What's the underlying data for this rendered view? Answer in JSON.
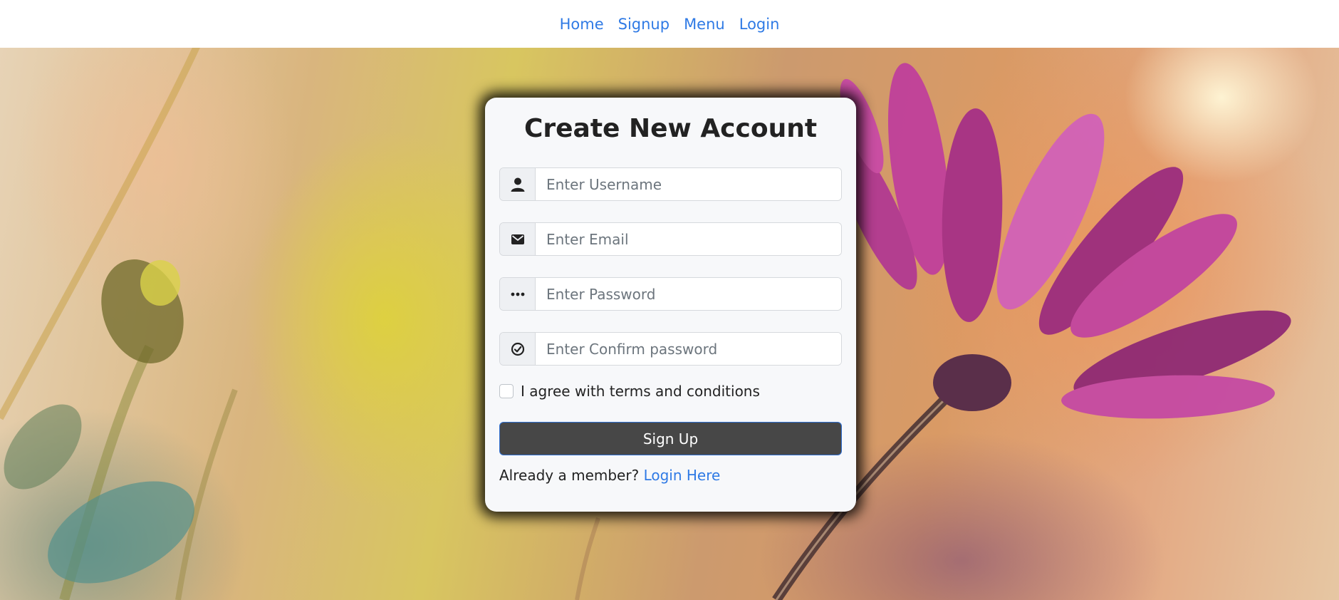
{
  "nav": {
    "items": [
      "Home",
      "Signup",
      "Menu",
      "Login"
    ]
  },
  "form": {
    "title": "Create New Account",
    "fields": [
      {
        "icon": "user-icon",
        "placeholder": "Enter Username",
        "value": ""
      },
      {
        "icon": "envelope-icon",
        "placeholder": "Enter Email",
        "value": ""
      },
      {
        "icon": "password-dots-icon",
        "placeholder": "Enter Password",
        "value": ""
      },
      {
        "icon": "check-circle-icon",
        "placeholder": "Enter Confirm password",
        "value": ""
      }
    ],
    "agree_label": "I agree with terms and conditions",
    "agree_checked": false,
    "submit_label": "Sign Up",
    "member_text": "Already a member?",
    "login_link": "Login Here"
  },
  "colors": {
    "link": "#2f7ae5",
    "button_bg": "#474747",
    "button_border": "#2f6fd1",
    "card_bg": "#f7f8fa"
  }
}
